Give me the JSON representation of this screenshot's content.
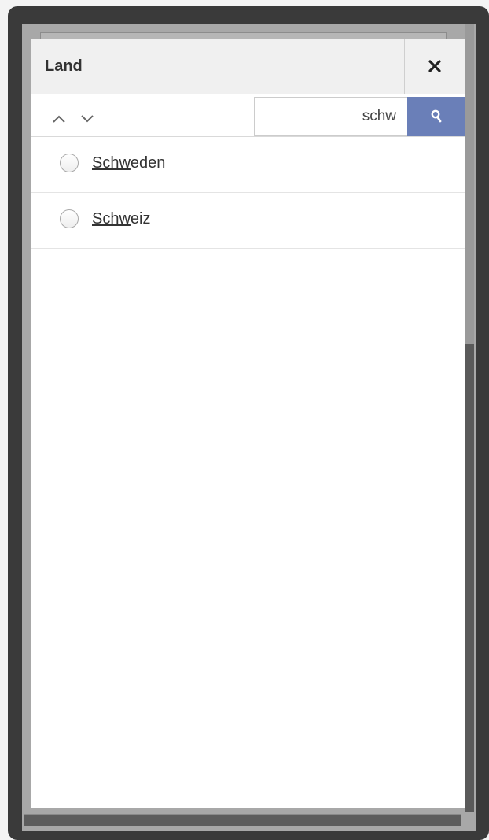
{
  "dialog": {
    "title": "Land",
    "close_icon": "close-icon"
  },
  "toolbar": {
    "up_icon": "chevron-up-icon",
    "down_icon": "chevron-down-icon",
    "search": {
      "value": "schw",
      "icon": "search-icon"
    }
  },
  "results": [
    {
      "match": "Schw",
      "rest": "eden"
    },
    {
      "match": "Schw",
      "rest": "eiz"
    }
  ],
  "colors": {
    "accent": "#6a7fb8",
    "header_bg": "#f0f0f0",
    "frame": "#3a3a3a"
  }
}
